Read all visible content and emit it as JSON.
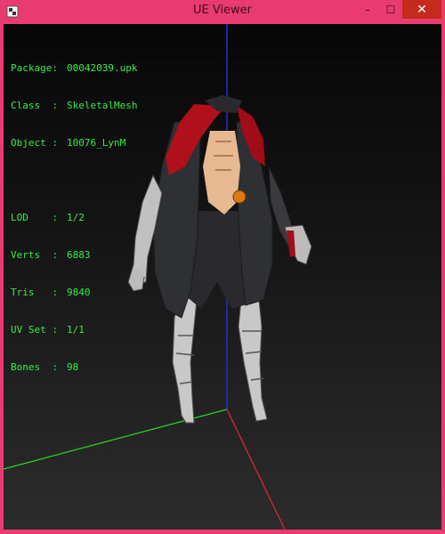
{
  "window": {
    "title": "UE Viewer",
    "icon": "ue-viewer-app-icon",
    "controls": {
      "minimize": "–",
      "maximize": "☐",
      "close": "✕"
    },
    "frame_color": "#ea3a72"
  },
  "info": {
    "package": {
      "label": "Package:",
      "value": "00042039.upk"
    },
    "class": {
      "label": "Class  :",
      "value": "SkeletalMesh"
    },
    "object": {
      "label": "Object :",
      "value": "10076_LynM"
    },
    "lod": {
      "label": "LOD    :",
      "value": "1/2"
    },
    "verts": {
      "label": "Verts  :",
      "value": "6883"
    },
    "tris": {
      "label": "Tris   :",
      "value": "9840"
    },
    "uvset": {
      "label": "UV Set :",
      "value": "1/1"
    },
    "bones": {
      "label": "Bones  :",
      "value": "98"
    }
  },
  "colors": {
    "info_text": "#33ee44",
    "axis_x": "#e0283c",
    "axis_y": "#22dd22",
    "axis_z": "#2233ee"
  }
}
